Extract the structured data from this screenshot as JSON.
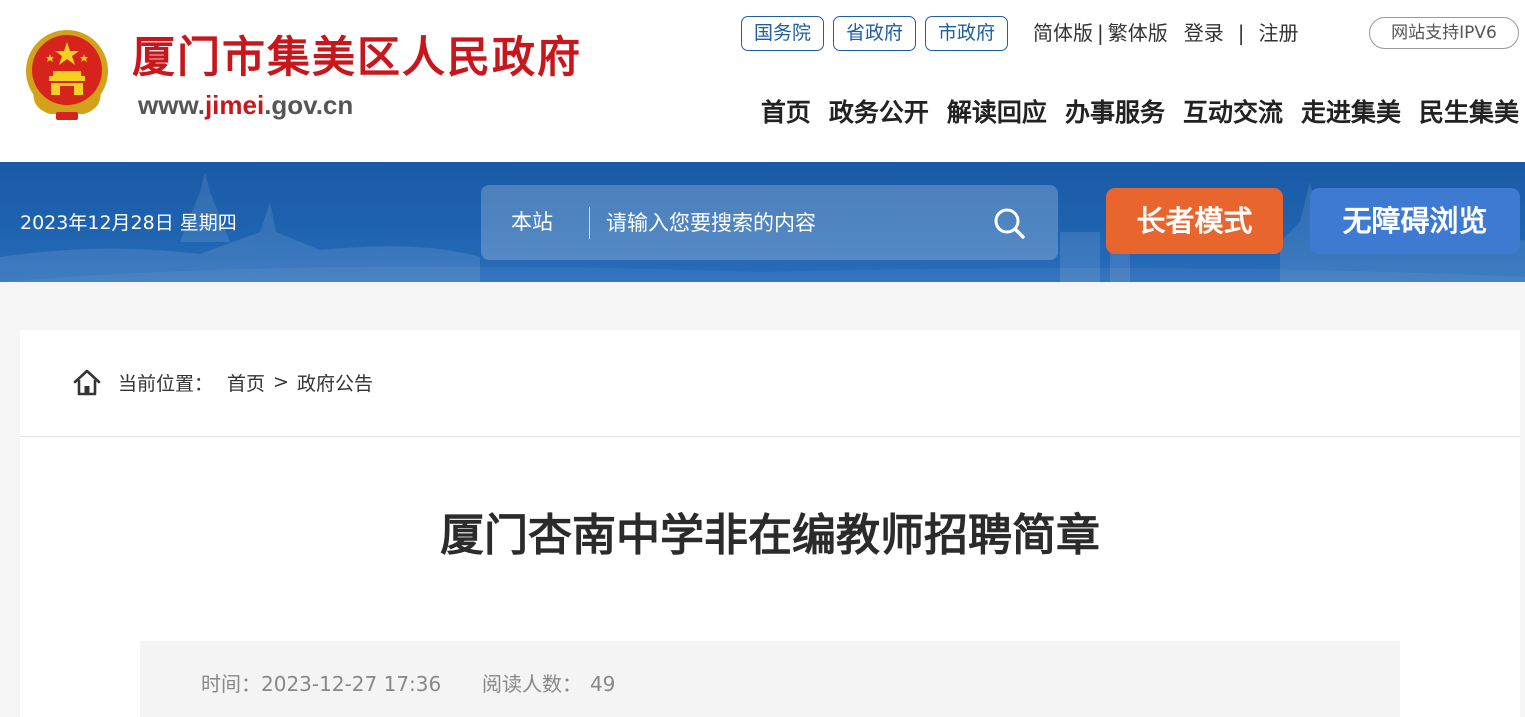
{
  "header": {
    "site_name": "厦门市集美区人民政府",
    "site_url_prefix": "www.",
    "site_url_highlight": "jimei",
    "site_url_suffix": ".gov.cn",
    "emblem_icon": "national-emblem-icon",
    "gov_links": [
      "国务院",
      "省政府",
      "市政府"
    ],
    "lang_simplified": "简体版",
    "lang_divider": "|",
    "lang_traditional": "繁体版",
    "login": "登录",
    "auth_divider": "|",
    "register": "注册",
    "ipv6_badge": "网站支持IPV6",
    "nav": [
      "首页",
      "政务公开",
      "解读回应",
      "办事服务",
      "互动交流",
      "走进集美",
      "民生集美"
    ],
    "colors": {
      "brand_red": "#c8161d",
      "link_blue": "#1d5ea4"
    }
  },
  "banner": {
    "date": "2023年12月28日 星期四",
    "search_scope": "本站",
    "search_placeholder": "请输入您要搜索的内容",
    "search_icon": "search-icon",
    "elder_mode": "长者模式",
    "accessible": "无障碍浏览",
    "colors": {
      "banner_blue": "#1e63b0",
      "elder_orange": "#e8652e",
      "access_blue": "#3f7ad2"
    }
  },
  "breadcrumb": {
    "icon": "home-icon",
    "label": "当前位置：",
    "items": [
      "首页",
      "政府公告"
    ],
    "separator": ">"
  },
  "article": {
    "title": "厦门杏南中学非在编教师招聘简章",
    "time_label": "时间：",
    "time_value": "2023-12-27 17:36",
    "views_label": "阅读人数：",
    "views_value": "49"
  }
}
